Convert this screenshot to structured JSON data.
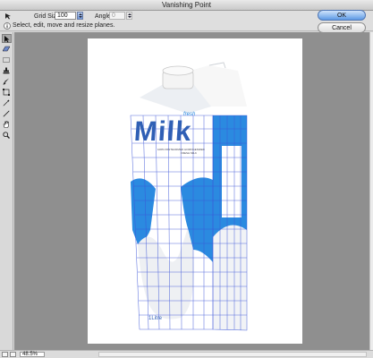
{
  "window": {
    "title": "Vanishing Point"
  },
  "options": {
    "grid_size_label": "Grid Size:",
    "grid_size_value": "100",
    "angle_label": "Angle:",
    "angle_value": "0"
  },
  "info": {
    "message": "Select, edit, move and resize planes."
  },
  "buttons": {
    "ok": "OK",
    "cancel": "Cancel"
  },
  "tools": [
    {
      "name": "edit-plane-tool",
      "active": true
    },
    {
      "name": "create-plane-tool",
      "active": false
    },
    {
      "name": "marquee-tool",
      "active": false
    },
    {
      "name": "stamp-tool",
      "active": false
    },
    {
      "name": "brush-tool",
      "active": false
    },
    {
      "name": "transform-tool",
      "active": false
    },
    {
      "name": "eyedropper-tool",
      "active": false
    },
    {
      "name": "measure-tool",
      "active": false
    },
    {
      "name": "hand-tool",
      "active": false
    },
    {
      "name": "zoom-tool",
      "active": false
    }
  ],
  "artwork": {
    "brand_small": "fresh",
    "brand": "Milk",
    "tagline_line1": "100% PASTEURIZED HOMOGENIZED",
    "tagline_line2": "FRESH MILK",
    "volume": "1Litre",
    "colors": {
      "brand_blue": "#2f5fb5",
      "carton_blue": "#2b8ae0",
      "grid": "#3c55d8"
    }
  },
  "status": {
    "zoom": "48.5%"
  }
}
